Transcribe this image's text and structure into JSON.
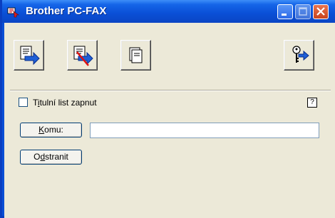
{
  "window": {
    "title": "Brother PC-FAX"
  },
  "toolbar": {
    "buttons": [
      {
        "name": "send-fax-button",
        "icon": "send-document-icon"
      },
      {
        "name": "cancel-send-button",
        "icon": "cancel-send-icon"
      },
      {
        "name": "address-book-button",
        "icon": "document-icon"
      },
      {
        "name": "setup-button",
        "icon": "key-arrow-icon"
      }
    ]
  },
  "cover_page": {
    "label_prefix": "T",
    "label_accel": "i",
    "label_rest": "tulní list zapnut",
    "checked": false,
    "help": "?"
  },
  "recipient": {
    "to_accel": "K",
    "to_rest": "omu:",
    "value": ""
  },
  "remove": {
    "accel_prefix": "O",
    "accel": "d",
    "rest": "stranit"
  },
  "colors": {
    "title_bar": "#0a4fd6",
    "client_bg": "#ece9d8",
    "close_button": "#c9441d"
  }
}
